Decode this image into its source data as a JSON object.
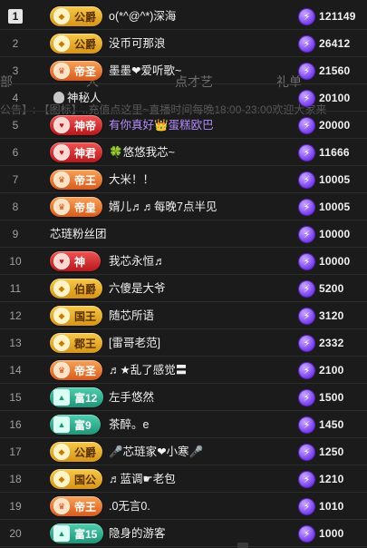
{
  "background": {
    "tabs": [
      "部",
      "人",
      "点才艺",
      "礼单"
    ],
    "notice": "公告】: 【图标】..充值点这里~直播时间每晚18:00-23:00欢迎大家来"
  },
  "rows": [
    {
      "rank": "1",
      "badge": "公爵",
      "badge_style": "gold",
      "name": "o(*^@^*)深海",
      "score": "121149"
    },
    {
      "rank": "2",
      "badge": "公爵",
      "badge_style": "gold",
      "name": "没币可那浪",
      "score": "26412"
    },
    {
      "rank": "3",
      "badge": "帝圣",
      "badge_style": "orange",
      "name": "墨墨❤爱听歌~",
      "score": "21560"
    },
    {
      "rank": "4",
      "badge": "",
      "badge_style": "secret",
      "name": "神秘人",
      "score": "20100"
    },
    {
      "rank": "5",
      "badge": "神帝",
      "badge_style": "red",
      "name": "有你真好👑蛋糕欧巴",
      "score": "20000"
    },
    {
      "rank": "6",
      "badge": "神君",
      "badge_style": "red",
      "name": "🍀悠悠我芯~",
      "score": "11666"
    },
    {
      "rank": "7",
      "badge": "帝王",
      "badge_style": "orange",
      "name": "大米！！",
      "score": "10005"
    },
    {
      "rank": "8",
      "badge": "帝皇",
      "badge_style": "orange",
      "name": "婿儿♬♬每晚7点半见",
      "score": "10005"
    },
    {
      "rank": "9",
      "badge": "",
      "badge_style": "none",
      "name": "芯琏粉丝团",
      "score": "10000"
    },
    {
      "rank": "10",
      "badge": "神",
      "badge_style": "red",
      "name": "我芯永恒♬",
      "score": "10000"
    },
    {
      "rank": "11",
      "badge": "伯爵",
      "badge_style": "gold",
      "name": "六傻是大爷",
      "score": "5200"
    },
    {
      "rank": "12",
      "badge": "国王",
      "badge_style": "gold",
      "name": "随芯所语",
      "score": "3120"
    },
    {
      "rank": "13",
      "badge": "郡王",
      "badge_style": "gold",
      "name": "[雷哥老范]",
      "score": "2332"
    },
    {
      "rank": "14",
      "badge": "帝圣",
      "badge_style": "orange",
      "name": "♬★乱了感觉〓",
      "score": "2100"
    },
    {
      "rank": "15",
      "badge": "富12",
      "badge_style": "teal",
      "name": "左手悠然",
      "score": "1500"
    },
    {
      "rank": "16",
      "badge": "富9",
      "badge_style": "teal",
      "name": "茶醉。e",
      "score": "1450"
    },
    {
      "rank": "17",
      "badge": "公爵",
      "badge_style": "gold",
      "name": "🎤芯琏家❤小寒🎤",
      "score": "1250"
    },
    {
      "rank": "18",
      "badge": "国公",
      "badge_style": "gold",
      "name": "♬蓝调☛老包",
      "score": "1210"
    },
    {
      "rank": "19",
      "badge": "帝王",
      "badge_style": "orange",
      "name": ".0无言0.",
      "score": "1010"
    },
    {
      "rank": "20",
      "badge": "富15",
      "badge_style": "teal",
      "name": "隐身的游客",
      "score": "1000"
    }
  ],
  "colors": {
    "background": "#1b1b1b",
    "score_icon": "#7a3ff0",
    "badge_gold": "#d69418",
    "badge_orange": "#d95b1a",
    "badge_red": "#b8181c",
    "badge_teal": "#1f9478"
  },
  "icons": {
    "score": "lightning-bolt-icon",
    "secret": "mystery-user-icon"
  }
}
